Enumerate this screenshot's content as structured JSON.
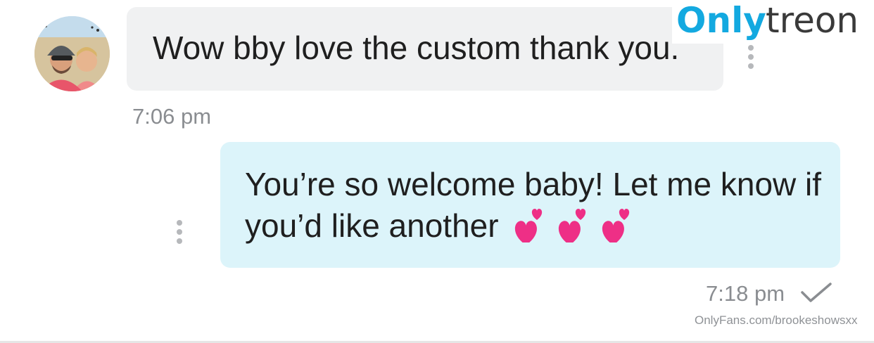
{
  "incoming": {
    "text": "Wow bby love the custom thank you.",
    "time": "7:06 pm",
    "avatar_icon": "avatar-photo"
  },
  "outgoing": {
    "text": "You’re so welcome baby! Let me know if you’d like another",
    "emoji": [
      "💕",
      "💕",
      "💕"
    ],
    "time": "7:18 pm",
    "status_icon": "checkmark-icon"
  },
  "watermark": {
    "logo_part1": "Only",
    "logo_part2": "treon",
    "url": "OnlyFans.com/brookeshowsxx"
  },
  "colors": {
    "incoming_bubble": "#f0f1f2",
    "outgoing_bubble": "#dcf4fa",
    "timestamp": "#8a8d91",
    "logo_blue": "#13a9e0"
  }
}
